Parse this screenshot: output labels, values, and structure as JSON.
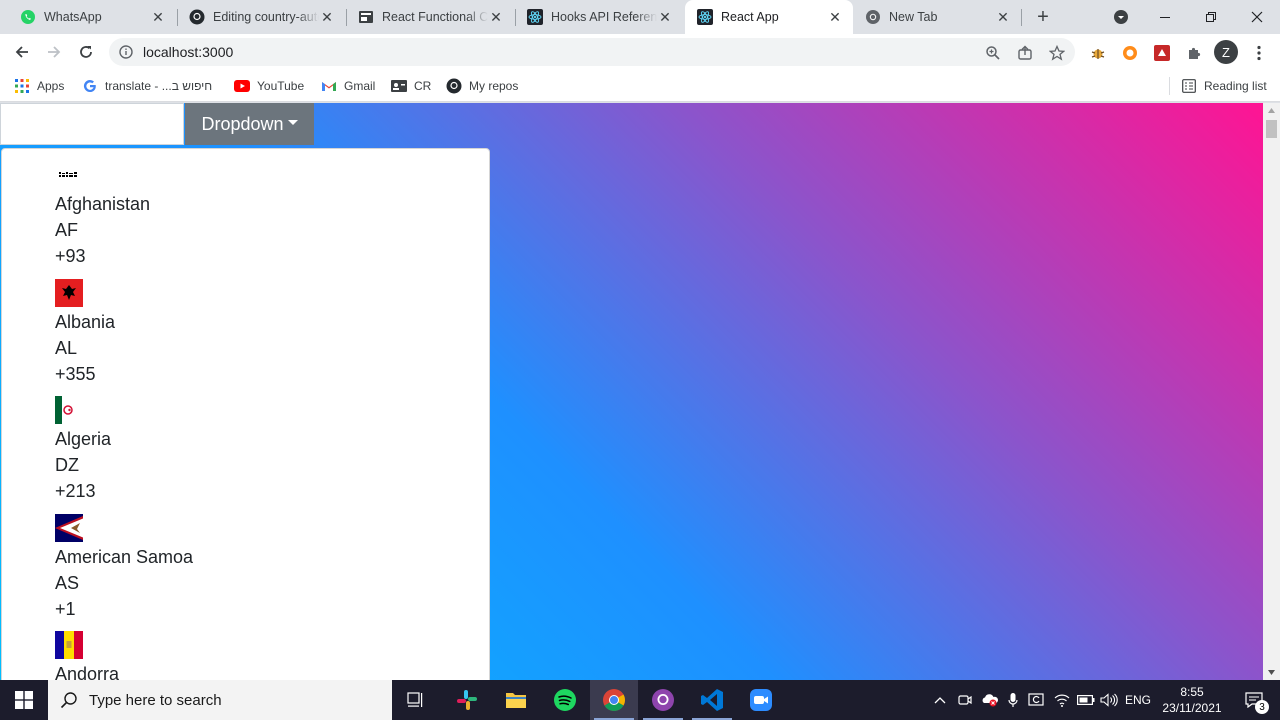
{
  "browser": {
    "tabs": [
      {
        "title": "WhatsApp",
        "icon": "whatsapp-icon",
        "active": false
      },
      {
        "title": "Editing country-auto",
        "icon": "github-icon",
        "active": false
      },
      {
        "title": "React Functional Co",
        "icon": "document-icon",
        "active": false
      },
      {
        "title": "Hooks API Reference",
        "icon": "react-icon",
        "active": false
      },
      {
        "title": "React App",
        "icon": "react-icon",
        "active": true
      },
      {
        "title": "New Tab",
        "icon": "chrome-icon",
        "active": false
      }
    ],
    "new_tab_label": "+",
    "url": "localhost:3000",
    "bookmarks": [
      {
        "label": "Apps",
        "icon": "apps-grid-icon"
      },
      {
        "label": "translate - ...חיפוש ב",
        "icon": "google-icon"
      },
      {
        "label": "YouTube",
        "icon": "youtube-icon"
      },
      {
        "label": "Gmail",
        "icon": "gmail-icon"
      },
      {
        "label": "CR",
        "icon": "cr-icon"
      },
      {
        "label": "My repos",
        "icon": "github-icon"
      }
    ],
    "reading_list_label": "Reading list",
    "profile_initial": "Z"
  },
  "page": {
    "dropdown_label": "Dropdown",
    "search_value": "",
    "countries": [
      {
        "name": "Afghanistan",
        "code": "AF",
        "dial": "+93"
      },
      {
        "name": "Albania",
        "code": "AL",
        "dial": "+355"
      },
      {
        "name": "Algeria",
        "code": "DZ",
        "dial": "+213"
      },
      {
        "name": "American Samoa",
        "code": "AS",
        "dial": "+1"
      },
      {
        "name": "Andorra",
        "code": "",
        "dial": ""
      }
    ]
  },
  "taskbar": {
    "search_placeholder": "Type here to search",
    "language": "ENG",
    "time": "8:55",
    "date": "23/11/2021",
    "notification_count": "3"
  },
  "colors": {
    "gradient_pink": "#ff1493",
    "gradient_blue": "#1e90ff",
    "gradient_cyan": "#00bfff",
    "dropdown_button": "#6c757d",
    "taskbar": "#1c1c2c"
  }
}
